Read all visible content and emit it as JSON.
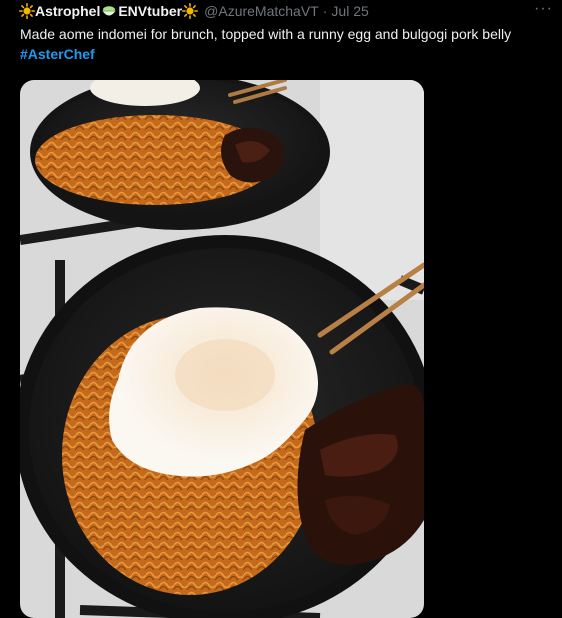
{
  "tweet": {
    "display_name_part1": "Astrophel",
    "display_name_part2": "ENVtuber",
    "handle": "@AzureMatchaVT",
    "separator": "·",
    "date": "Jul 25",
    "more_label": "···",
    "text": "Made aome indomei for brunch, topped with a runny egg and bulgogi pork belly",
    "hashtag": "#AsterChef"
  },
  "icons": {
    "name_prefix": "sun-emoji-icon",
    "name_middle": "bowl-emoji-icon",
    "name_suffix": "sun-emoji-icon",
    "more": "more-options-icon"
  },
  "colors": {
    "background": "#000000",
    "hashtag": "#1d9bf0",
    "secondary_text": "#71767b",
    "sun": "#f4b400"
  }
}
